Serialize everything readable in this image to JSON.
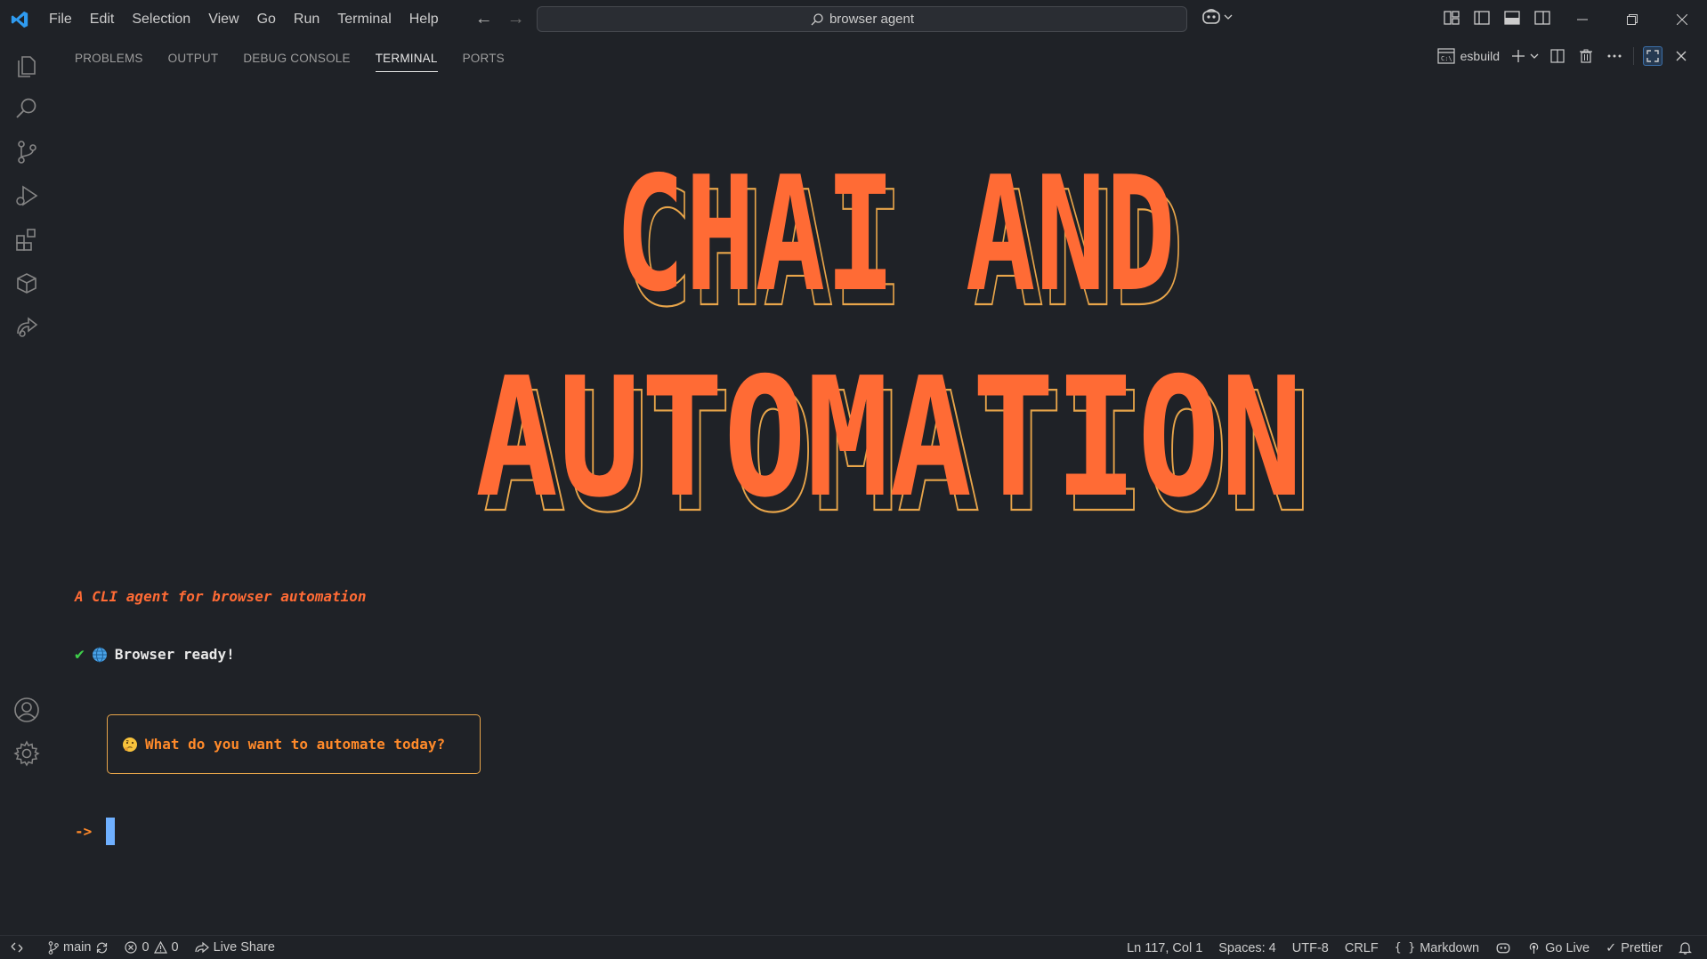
{
  "menu": [
    "File",
    "Edit",
    "Selection",
    "View",
    "Go",
    "Run",
    "Terminal",
    "Help"
  ],
  "search": {
    "text": "browser agent"
  },
  "panel": {
    "tabs": [
      "PROBLEMS",
      "OUTPUT",
      "DEBUG CONSOLE",
      "TERMINAL",
      "PORTS"
    ],
    "active_tab": "TERMINAL",
    "terminal_name": "esbuild"
  },
  "terminal": {
    "banner_line1": "CHAI AND",
    "banner_line2": "AUTOMATION",
    "tagline": "A CLI agent for browser automation",
    "ready": "Browser ready!",
    "prompt": "What do you want to automate today?",
    "input_prefix": "->"
  },
  "status": {
    "branch": "main",
    "errors": "0",
    "warnings": "0",
    "live_share": "Live Share",
    "position": "Ln 117, Col 1",
    "spaces": "Spaces: 4",
    "encoding": "UTF-8",
    "eol": "CRLF",
    "language": "Markdown",
    "go_live": "Go Live",
    "prettier": "Prettier"
  },
  "colors": {
    "banner_fill": "#ff6b35",
    "banner_outline": "#e8a54a",
    "accent_blue": "#3b8eea",
    "check_green": "#3fcf4a"
  }
}
